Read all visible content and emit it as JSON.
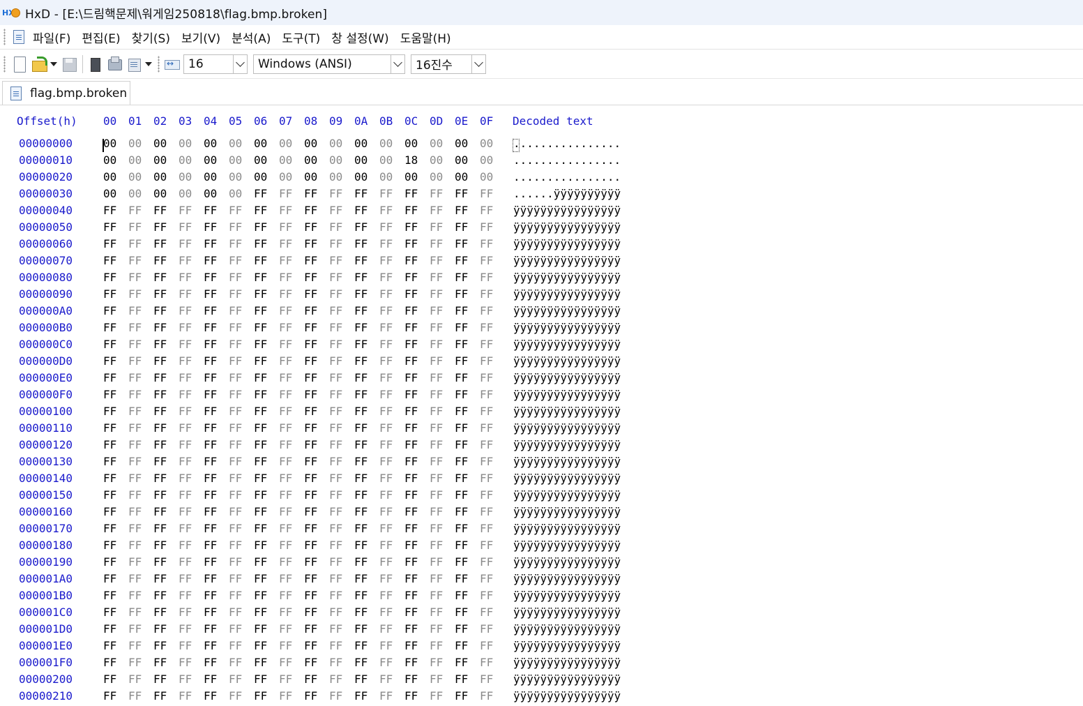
{
  "titlebar": {
    "title": "HxD - [E:\\드림핵문제\\워게임250818\\flag.bmp.broken]"
  },
  "menu": {
    "items": [
      "파일(F)",
      "편집(E)",
      "찾기(S)",
      "보기(V)",
      "분석(A)",
      "도구(T)",
      "창 설정(W)",
      "도움말(H)"
    ]
  },
  "toolbar": {
    "bytes_per_row": "16",
    "charset": "Windows (ANSI)",
    "offset_base": "16진수"
  },
  "tab": {
    "label": "flag.bmp.broken"
  },
  "hex": {
    "offset_header": "Offset(h)",
    "columns": [
      "00",
      "01",
      "02",
      "03",
      "04",
      "05",
      "06",
      "07",
      "08",
      "09",
      "0A",
      "0B",
      "0C",
      "0D",
      "0E",
      "0F"
    ],
    "decoded_header": "Decoded text",
    "rows": [
      {
        "offset": "00000000",
        "bytes": [
          "00",
          "00",
          "00",
          "00",
          "00",
          "00",
          "00",
          "00",
          "00",
          "00",
          "00",
          "00",
          "00",
          "00",
          "00",
          "00"
        ],
        "text": "................"
      },
      {
        "offset": "00000010",
        "bytes": [
          "00",
          "00",
          "00",
          "00",
          "00",
          "00",
          "00",
          "00",
          "00",
          "00",
          "00",
          "00",
          "18",
          "00",
          "00",
          "00"
        ],
        "text": "................"
      },
      {
        "offset": "00000020",
        "bytes": [
          "00",
          "00",
          "00",
          "00",
          "00",
          "00",
          "00",
          "00",
          "00",
          "00",
          "00",
          "00",
          "00",
          "00",
          "00",
          "00"
        ],
        "text": "................"
      },
      {
        "offset": "00000030",
        "bytes": [
          "00",
          "00",
          "00",
          "00",
          "00",
          "00",
          "FF",
          "FF",
          "FF",
          "FF",
          "FF",
          "FF",
          "FF",
          "FF",
          "FF",
          "FF"
        ],
        "text": "......ÿÿÿÿÿÿÿÿÿÿ"
      },
      {
        "offset": "00000040",
        "bytes": [
          "FF",
          "FF",
          "FF",
          "FF",
          "FF",
          "FF",
          "FF",
          "FF",
          "FF",
          "FF",
          "FF",
          "FF",
          "FF",
          "FF",
          "FF",
          "FF"
        ],
        "text": "ÿÿÿÿÿÿÿÿÿÿÿÿÿÿÿÿ"
      },
      {
        "offset": "00000050",
        "bytes": [
          "FF",
          "FF",
          "FF",
          "FF",
          "FF",
          "FF",
          "FF",
          "FF",
          "FF",
          "FF",
          "FF",
          "FF",
          "FF",
          "FF",
          "FF",
          "FF"
        ],
        "text": "ÿÿÿÿÿÿÿÿÿÿÿÿÿÿÿÿ"
      },
      {
        "offset": "00000060",
        "bytes": [
          "FF",
          "FF",
          "FF",
          "FF",
          "FF",
          "FF",
          "FF",
          "FF",
          "FF",
          "FF",
          "FF",
          "FF",
          "FF",
          "FF",
          "FF",
          "FF"
        ],
        "text": "ÿÿÿÿÿÿÿÿÿÿÿÿÿÿÿÿ"
      },
      {
        "offset": "00000070",
        "bytes": [
          "FF",
          "FF",
          "FF",
          "FF",
          "FF",
          "FF",
          "FF",
          "FF",
          "FF",
          "FF",
          "FF",
          "FF",
          "FF",
          "FF",
          "FF",
          "FF"
        ],
        "text": "ÿÿÿÿÿÿÿÿÿÿÿÿÿÿÿÿ"
      },
      {
        "offset": "00000080",
        "bytes": [
          "FF",
          "FF",
          "FF",
          "FF",
          "FF",
          "FF",
          "FF",
          "FF",
          "FF",
          "FF",
          "FF",
          "FF",
          "FF",
          "FF",
          "FF",
          "FF"
        ],
        "text": "ÿÿÿÿÿÿÿÿÿÿÿÿÿÿÿÿ"
      },
      {
        "offset": "00000090",
        "bytes": [
          "FF",
          "FF",
          "FF",
          "FF",
          "FF",
          "FF",
          "FF",
          "FF",
          "FF",
          "FF",
          "FF",
          "FF",
          "FF",
          "FF",
          "FF",
          "FF"
        ],
        "text": "ÿÿÿÿÿÿÿÿÿÿÿÿÿÿÿÿ"
      },
      {
        "offset": "000000A0",
        "bytes": [
          "FF",
          "FF",
          "FF",
          "FF",
          "FF",
          "FF",
          "FF",
          "FF",
          "FF",
          "FF",
          "FF",
          "FF",
          "FF",
          "FF",
          "FF",
          "FF"
        ],
        "text": "ÿÿÿÿÿÿÿÿÿÿÿÿÿÿÿÿ"
      },
      {
        "offset": "000000B0",
        "bytes": [
          "FF",
          "FF",
          "FF",
          "FF",
          "FF",
          "FF",
          "FF",
          "FF",
          "FF",
          "FF",
          "FF",
          "FF",
          "FF",
          "FF",
          "FF",
          "FF"
        ],
        "text": "ÿÿÿÿÿÿÿÿÿÿÿÿÿÿÿÿ"
      },
      {
        "offset": "000000C0",
        "bytes": [
          "FF",
          "FF",
          "FF",
          "FF",
          "FF",
          "FF",
          "FF",
          "FF",
          "FF",
          "FF",
          "FF",
          "FF",
          "FF",
          "FF",
          "FF",
          "FF"
        ],
        "text": "ÿÿÿÿÿÿÿÿÿÿÿÿÿÿÿÿ"
      },
      {
        "offset": "000000D0",
        "bytes": [
          "FF",
          "FF",
          "FF",
          "FF",
          "FF",
          "FF",
          "FF",
          "FF",
          "FF",
          "FF",
          "FF",
          "FF",
          "FF",
          "FF",
          "FF",
          "FF"
        ],
        "text": "ÿÿÿÿÿÿÿÿÿÿÿÿÿÿÿÿ"
      },
      {
        "offset": "000000E0",
        "bytes": [
          "FF",
          "FF",
          "FF",
          "FF",
          "FF",
          "FF",
          "FF",
          "FF",
          "FF",
          "FF",
          "FF",
          "FF",
          "FF",
          "FF",
          "FF",
          "FF"
        ],
        "text": "ÿÿÿÿÿÿÿÿÿÿÿÿÿÿÿÿ"
      },
      {
        "offset": "000000F0",
        "bytes": [
          "FF",
          "FF",
          "FF",
          "FF",
          "FF",
          "FF",
          "FF",
          "FF",
          "FF",
          "FF",
          "FF",
          "FF",
          "FF",
          "FF",
          "FF",
          "FF"
        ],
        "text": "ÿÿÿÿÿÿÿÿÿÿÿÿÿÿÿÿ"
      },
      {
        "offset": "00000100",
        "bytes": [
          "FF",
          "FF",
          "FF",
          "FF",
          "FF",
          "FF",
          "FF",
          "FF",
          "FF",
          "FF",
          "FF",
          "FF",
          "FF",
          "FF",
          "FF",
          "FF"
        ],
        "text": "ÿÿÿÿÿÿÿÿÿÿÿÿÿÿÿÿ"
      },
      {
        "offset": "00000110",
        "bytes": [
          "FF",
          "FF",
          "FF",
          "FF",
          "FF",
          "FF",
          "FF",
          "FF",
          "FF",
          "FF",
          "FF",
          "FF",
          "FF",
          "FF",
          "FF",
          "FF"
        ],
        "text": "ÿÿÿÿÿÿÿÿÿÿÿÿÿÿÿÿ"
      },
      {
        "offset": "00000120",
        "bytes": [
          "FF",
          "FF",
          "FF",
          "FF",
          "FF",
          "FF",
          "FF",
          "FF",
          "FF",
          "FF",
          "FF",
          "FF",
          "FF",
          "FF",
          "FF",
          "FF"
        ],
        "text": "ÿÿÿÿÿÿÿÿÿÿÿÿÿÿÿÿ"
      },
      {
        "offset": "00000130",
        "bytes": [
          "FF",
          "FF",
          "FF",
          "FF",
          "FF",
          "FF",
          "FF",
          "FF",
          "FF",
          "FF",
          "FF",
          "FF",
          "FF",
          "FF",
          "FF",
          "FF"
        ],
        "text": "ÿÿÿÿÿÿÿÿÿÿÿÿÿÿÿÿ"
      },
      {
        "offset": "00000140",
        "bytes": [
          "FF",
          "FF",
          "FF",
          "FF",
          "FF",
          "FF",
          "FF",
          "FF",
          "FF",
          "FF",
          "FF",
          "FF",
          "FF",
          "FF",
          "FF",
          "FF"
        ],
        "text": "ÿÿÿÿÿÿÿÿÿÿÿÿÿÿÿÿ"
      },
      {
        "offset": "00000150",
        "bytes": [
          "FF",
          "FF",
          "FF",
          "FF",
          "FF",
          "FF",
          "FF",
          "FF",
          "FF",
          "FF",
          "FF",
          "FF",
          "FF",
          "FF",
          "FF",
          "FF"
        ],
        "text": "ÿÿÿÿÿÿÿÿÿÿÿÿÿÿÿÿ"
      },
      {
        "offset": "00000160",
        "bytes": [
          "FF",
          "FF",
          "FF",
          "FF",
          "FF",
          "FF",
          "FF",
          "FF",
          "FF",
          "FF",
          "FF",
          "FF",
          "FF",
          "FF",
          "FF",
          "FF"
        ],
        "text": "ÿÿÿÿÿÿÿÿÿÿÿÿÿÿÿÿ"
      },
      {
        "offset": "00000170",
        "bytes": [
          "FF",
          "FF",
          "FF",
          "FF",
          "FF",
          "FF",
          "FF",
          "FF",
          "FF",
          "FF",
          "FF",
          "FF",
          "FF",
          "FF",
          "FF",
          "FF"
        ],
        "text": "ÿÿÿÿÿÿÿÿÿÿÿÿÿÿÿÿ"
      },
      {
        "offset": "00000180",
        "bytes": [
          "FF",
          "FF",
          "FF",
          "FF",
          "FF",
          "FF",
          "FF",
          "FF",
          "FF",
          "FF",
          "FF",
          "FF",
          "FF",
          "FF",
          "FF",
          "FF"
        ],
        "text": "ÿÿÿÿÿÿÿÿÿÿÿÿÿÿÿÿ"
      },
      {
        "offset": "00000190",
        "bytes": [
          "FF",
          "FF",
          "FF",
          "FF",
          "FF",
          "FF",
          "FF",
          "FF",
          "FF",
          "FF",
          "FF",
          "FF",
          "FF",
          "FF",
          "FF",
          "FF"
        ],
        "text": "ÿÿÿÿÿÿÿÿÿÿÿÿÿÿÿÿ"
      },
      {
        "offset": "000001A0",
        "bytes": [
          "FF",
          "FF",
          "FF",
          "FF",
          "FF",
          "FF",
          "FF",
          "FF",
          "FF",
          "FF",
          "FF",
          "FF",
          "FF",
          "FF",
          "FF",
          "FF"
        ],
        "text": "ÿÿÿÿÿÿÿÿÿÿÿÿÿÿÿÿ"
      },
      {
        "offset": "000001B0",
        "bytes": [
          "FF",
          "FF",
          "FF",
          "FF",
          "FF",
          "FF",
          "FF",
          "FF",
          "FF",
          "FF",
          "FF",
          "FF",
          "FF",
          "FF",
          "FF",
          "FF"
        ],
        "text": "ÿÿÿÿÿÿÿÿÿÿÿÿÿÿÿÿ"
      },
      {
        "offset": "000001C0",
        "bytes": [
          "FF",
          "FF",
          "FF",
          "FF",
          "FF",
          "FF",
          "FF",
          "FF",
          "FF",
          "FF",
          "FF",
          "FF",
          "FF",
          "FF",
          "FF",
          "FF"
        ],
        "text": "ÿÿÿÿÿÿÿÿÿÿÿÿÿÿÿÿ"
      },
      {
        "offset": "000001D0",
        "bytes": [
          "FF",
          "FF",
          "FF",
          "FF",
          "FF",
          "FF",
          "FF",
          "FF",
          "FF",
          "FF",
          "FF",
          "FF",
          "FF",
          "FF",
          "FF",
          "FF"
        ],
        "text": "ÿÿÿÿÿÿÿÿÿÿÿÿÿÿÿÿ"
      },
      {
        "offset": "000001E0",
        "bytes": [
          "FF",
          "FF",
          "FF",
          "FF",
          "FF",
          "FF",
          "FF",
          "FF",
          "FF",
          "FF",
          "FF",
          "FF",
          "FF",
          "FF",
          "FF",
          "FF"
        ],
        "text": "ÿÿÿÿÿÿÿÿÿÿÿÿÿÿÿÿ"
      },
      {
        "offset": "000001F0",
        "bytes": [
          "FF",
          "FF",
          "FF",
          "FF",
          "FF",
          "FF",
          "FF",
          "FF",
          "FF",
          "FF",
          "FF",
          "FF",
          "FF",
          "FF",
          "FF",
          "FF"
        ],
        "text": "ÿÿÿÿÿÿÿÿÿÿÿÿÿÿÿÿ"
      },
      {
        "offset": "00000200",
        "bytes": [
          "FF",
          "FF",
          "FF",
          "FF",
          "FF",
          "FF",
          "FF",
          "FF",
          "FF",
          "FF",
          "FF",
          "FF",
          "FF",
          "FF",
          "FF",
          "FF"
        ],
        "text": "ÿÿÿÿÿÿÿÿÿÿÿÿÿÿÿÿ"
      },
      {
        "offset": "00000210",
        "bytes": [
          "FF",
          "FF",
          "FF",
          "FF",
          "FF",
          "FF",
          "FF",
          "FF",
          "FF",
          "FF",
          "FF",
          "FF",
          "FF",
          "FF",
          "FF",
          "FF"
        ],
        "text": "ÿÿÿÿÿÿÿÿÿÿÿÿÿÿÿÿ"
      }
    ]
  },
  "colors": {
    "offset_blue": "#1a1acc",
    "odd_column_gray": "#8a8a8a",
    "titlebar_bg": "#eef3fb"
  },
  "icons": [
    "hxd-app-icon",
    "document-icon",
    "new-file-icon",
    "open-file-icon",
    "save-icon",
    "close-file-icon",
    "open-disk-icon",
    "open-ram-icon",
    "bytes-per-row-icon",
    "dropdown-arrow-icon"
  ]
}
